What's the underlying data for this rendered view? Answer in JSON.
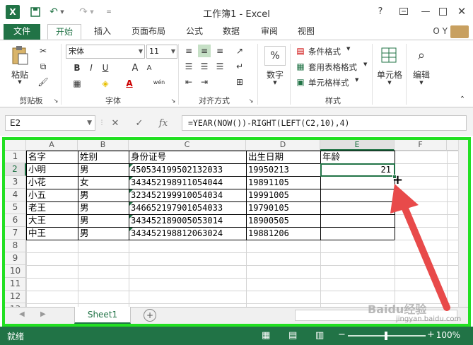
{
  "app": {
    "logo_letter": "X",
    "title": "工作簿1 - Excel",
    "help": "?",
    "user": "O Y"
  },
  "tabs": [
    "文件",
    "开始",
    "插入",
    "页面布局",
    "公式",
    "数据",
    "审阅",
    "视图"
  ],
  "ribbon": {
    "clipboard": {
      "paste": "粘贴",
      "label": "剪贴板"
    },
    "font": {
      "name": "宋体",
      "size": "11",
      "label": "字体",
      "bold": "B",
      "italic": "I",
      "underline": "U",
      "grow": "A",
      "shrink": "A",
      "wen": "wén"
    },
    "alignment": {
      "label": "对齐方式"
    },
    "number": {
      "button": "数字",
      "percent": "%"
    },
    "styles": {
      "conditional": "条件格式",
      "table": "套用表格格式",
      "cell": "单元格样式",
      "label": "样式"
    },
    "cells": {
      "button": "单元格"
    },
    "editing": {
      "button": "编辑"
    }
  },
  "formula_bar": {
    "name_box": "E2",
    "fx": "fx",
    "formula": "=YEAR(NOW())-RIGHT(LEFT(C2,10),4)"
  },
  "sheet": {
    "columns": [
      "A",
      "B",
      "C",
      "D",
      "E",
      "F"
    ],
    "row_numbers": [
      "1",
      "2",
      "3",
      "4",
      "5",
      "6",
      "7",
      "8",
      "9",
      "10",
      "11",
      "12",
      "13"
    ],
    "headers": [
      "名字",
      "姓别",
      "身份证号",
      "出生日期",
      "年龄"
    ],
    "rows": [
      [
        "小明",
        "男",
        "450534199502132033",
        "19950213",
        "21"
      ],
      [
        "小花",
        "女",
        "343452198911054044",
        "19891105",
        ""
      ],
      [
        "小五",
        "男",
        "323452199910054034",
        "19991005",
        ""
      ],
      [
        "老王",
        "男",
        "346652197901054033",
        "19790105",
        ""
      ],
      [
        "大王",
        "男",
        "343452189005053014",
        "18900505",
        ""
      ],
      [
        "中王",
        "男",
        "343452198812063024",
        "19881206",
        ""
      ]
    ],
    "selected_cell": "E2"
  },
  "sheet_tabs": [
    "Sheet1"
  ],
  "status": {
    "text": "就绪",
    "zoom": "100%"
  },
  "watermark": {
    "main": "Baidu经验",
    "sub": "jingyan.baidu.com"
  },
  "colors": {
    "accent": "#217346",
    "frame": "#22e022",
    "arrow": "#e84a4a"
  }
}
